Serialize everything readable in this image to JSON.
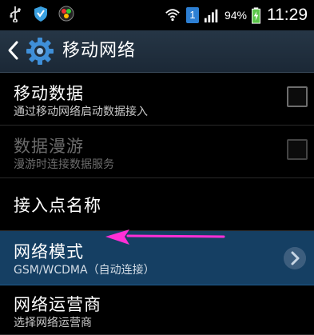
{
  "status_bar": {
    "battery_percent": "94%",
    "time": "11:29",
    "sim_label": "1",
    "icons": [
      "usb-icon",
      "shield-icon",
      "app-icon",
      "wifi-icon",
      "sim-icon",
      "signal-icon",
      "battery-icon"
    ]
  },
  "action_bar": {
    "title": "移动网络"
  },
  "items": [
    {
      "title": "移动数据",
      "subtitle": "通过移动网络启动数据接入",
      "enabled": true,
      "control": "checkbox",
      "checked": false
    },
    {
      "title": "数据漫游",
      "subtitle": "漫游时连接数据服务",
      "enabled": false,
      "control": "checkbox",
      "checked": false
    },
    {
      "title": "接入点名称",
      "subtitle": "",
      "enabled": true
    },
    {
      "title": "网络模式",
      "subtitle": "GSM/WCDMA（自动连接）",
      "enabled": true,
      "highlighted": true
    },
    {
      "title": "网络运营商",
      "subtitle": "选择网络运营商",
      "enabled": true
    }
  ],
  "colors": {
    "highlight_row": "#153f63",
    "annotation_arrow": "#ff2fd6",
    "action_bar": "#263646"
  }
}
